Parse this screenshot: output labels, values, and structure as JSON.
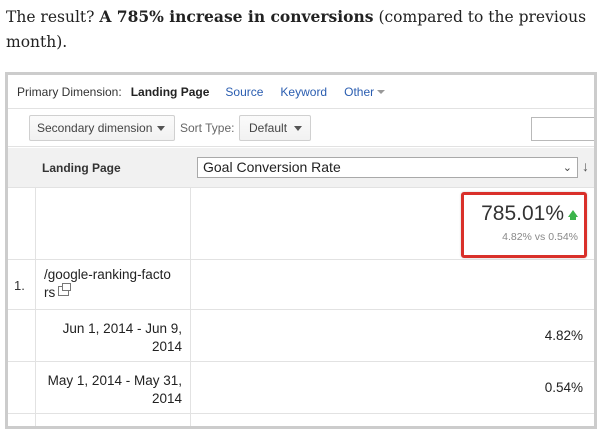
{
  "intro": {
    "lead": "The result? ",
    "bold": "A 785% increase in conversions",
    "rest": " (compared to the previous month)."
  },
  "dimension_bar": {
    "label": "Primary Dimension:",
    "active": "Landing Page",
    "links": [
      "Source",
      "Keyword",
      "Other"
    ]
  },
  "filters": {
    "secondary_dimension": "Secondary dimension",
    "sort_type_label": "Sort Type:",
    "sort_type_value": "Default",
    "search_value": ""
  },
  "table": {
    "column_header": "Landing Page",
    "metric_selected": "Goal Conversion Rate",
    "summary": {
      "change": "785.01%",
      "comparison": "4.82% vs 0.54%",
      "trend": "up"
    },
    "rows": [
      {
        "index": "1.",
        "page": "/google-ranking-factors",
        "periods": [
          {
            "range": "Jun 1, 2014 - Jun 9, 2014",
            "value": "4.82%"
          },
          {
            "range": "May 1, 2014 - May 31, 2014",
            "value": "0.54%"
          }
        ]
      }
    ]
  },
  "colors": {
    "link": "#2a5db0",
    "highlight_border": "#d9302a",
    "trend_up": "#3cb44b",
    "header_bg": "#f1f1f1"
  },
  "icons": [
    "chevron-down-icon",
    "sort-down-arrow-icon",
    "trend-up-icon",
    "external-link-icon"
  ]
}
